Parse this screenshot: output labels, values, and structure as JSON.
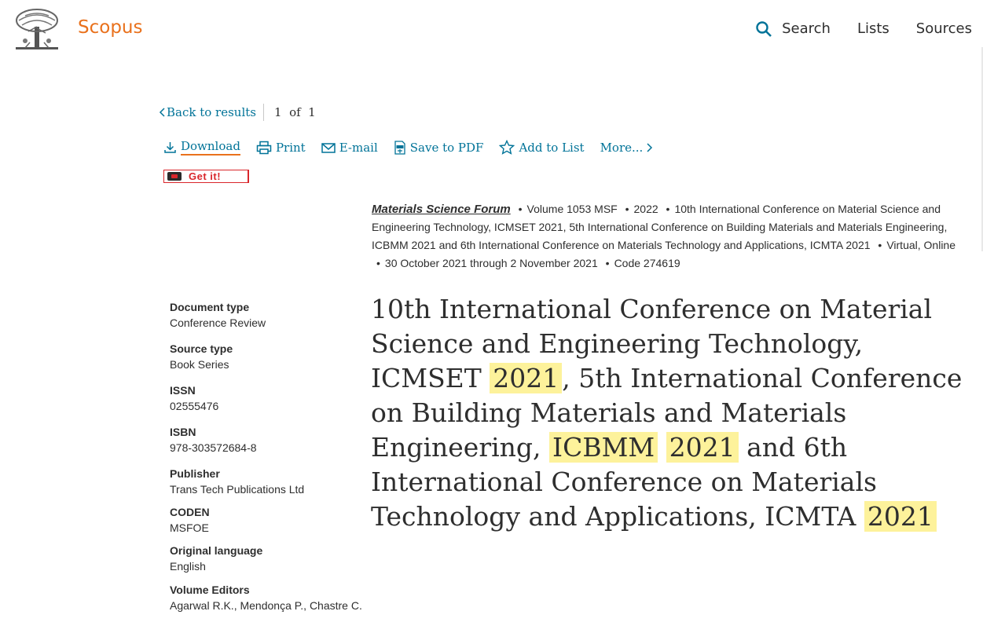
{
  "header": {
    "brand": "Scopus",
    "nav": {
      "search": "Search",
      "lists": "Lists",
      "sources": "Sources"
    }
  },
  "backbar": {
    "back_label": "Back to results",
    "pager": "1  of  1"
  },
  "toolbar": {
    "download": "Download",
    "print": "Print",
    "email": "E-mail",
    "save_pdf": "Save to PDF",
    "add_list": "Add to List",
    "more": "More..."
  },
  "getit": {
    "label": "Get it!"
  },
  "source": {
    "journal": "Materials Science Forum",
    "volume": "Volume 1053 MSF",
    "year": "2022",
    "conference": "10th International Conference on Material Science and Engineering Technology, ICMSET 2021, 5th International Conference on Building Materials and Materials Engineering, ICBMM 2021 and 6th International Conference on Materials Technology and Applications, ICMTA 2021",
    "location": "Virtual, Online",
    "dates": "30 October 2021 through 2 November 2021",
    "code": "Code 274619"
  },
  "title": {
    "p1": "10th International Conference on Material Science and Engineering Technology, ICMSET ",
    "h1": "2021",
    "p2": ", 5th International Conference on Building Materials and Materials Engineering, ",
    "h2": "ICBMM",
    "p3": " ",
    "h3": "2021",
    "p4": " and 6th International Conference on Materials Technology and Applications, ICMTA ",
    "h4": "2021"
  },
  "details": {
    "document_type": {
      "label": "Document type",
      "value": "Conference Review"
    },
    "source_type": {
      "label": "Source type",
      "value": "Book Series"
    },
    "issn": {
      "label": "ISSN",
      "value": "02555476"
    },
    "isbn": {
      "label": "ISBN",
      "value": "978-303572684-8"
    },
    "publisher": {
      "label": "Publisher",
      "value": "Trans Tech Publications Ltd"
    },
    "coden": {
      "label": "CODEN",
      "value": "MSFOE"
    },
    "language": {
      "label": "Original language",
      "value": "English"
    },
    "editors": {
      "label": "Volume Editors",
      "value": "Agarwal R.K., Mendonça P., Chastre C."
    }
  },
  "colors": {
    "accent": "#e9711c",
    "link": "#007398",
    "highlight": "#fdf29b"
  }
}
